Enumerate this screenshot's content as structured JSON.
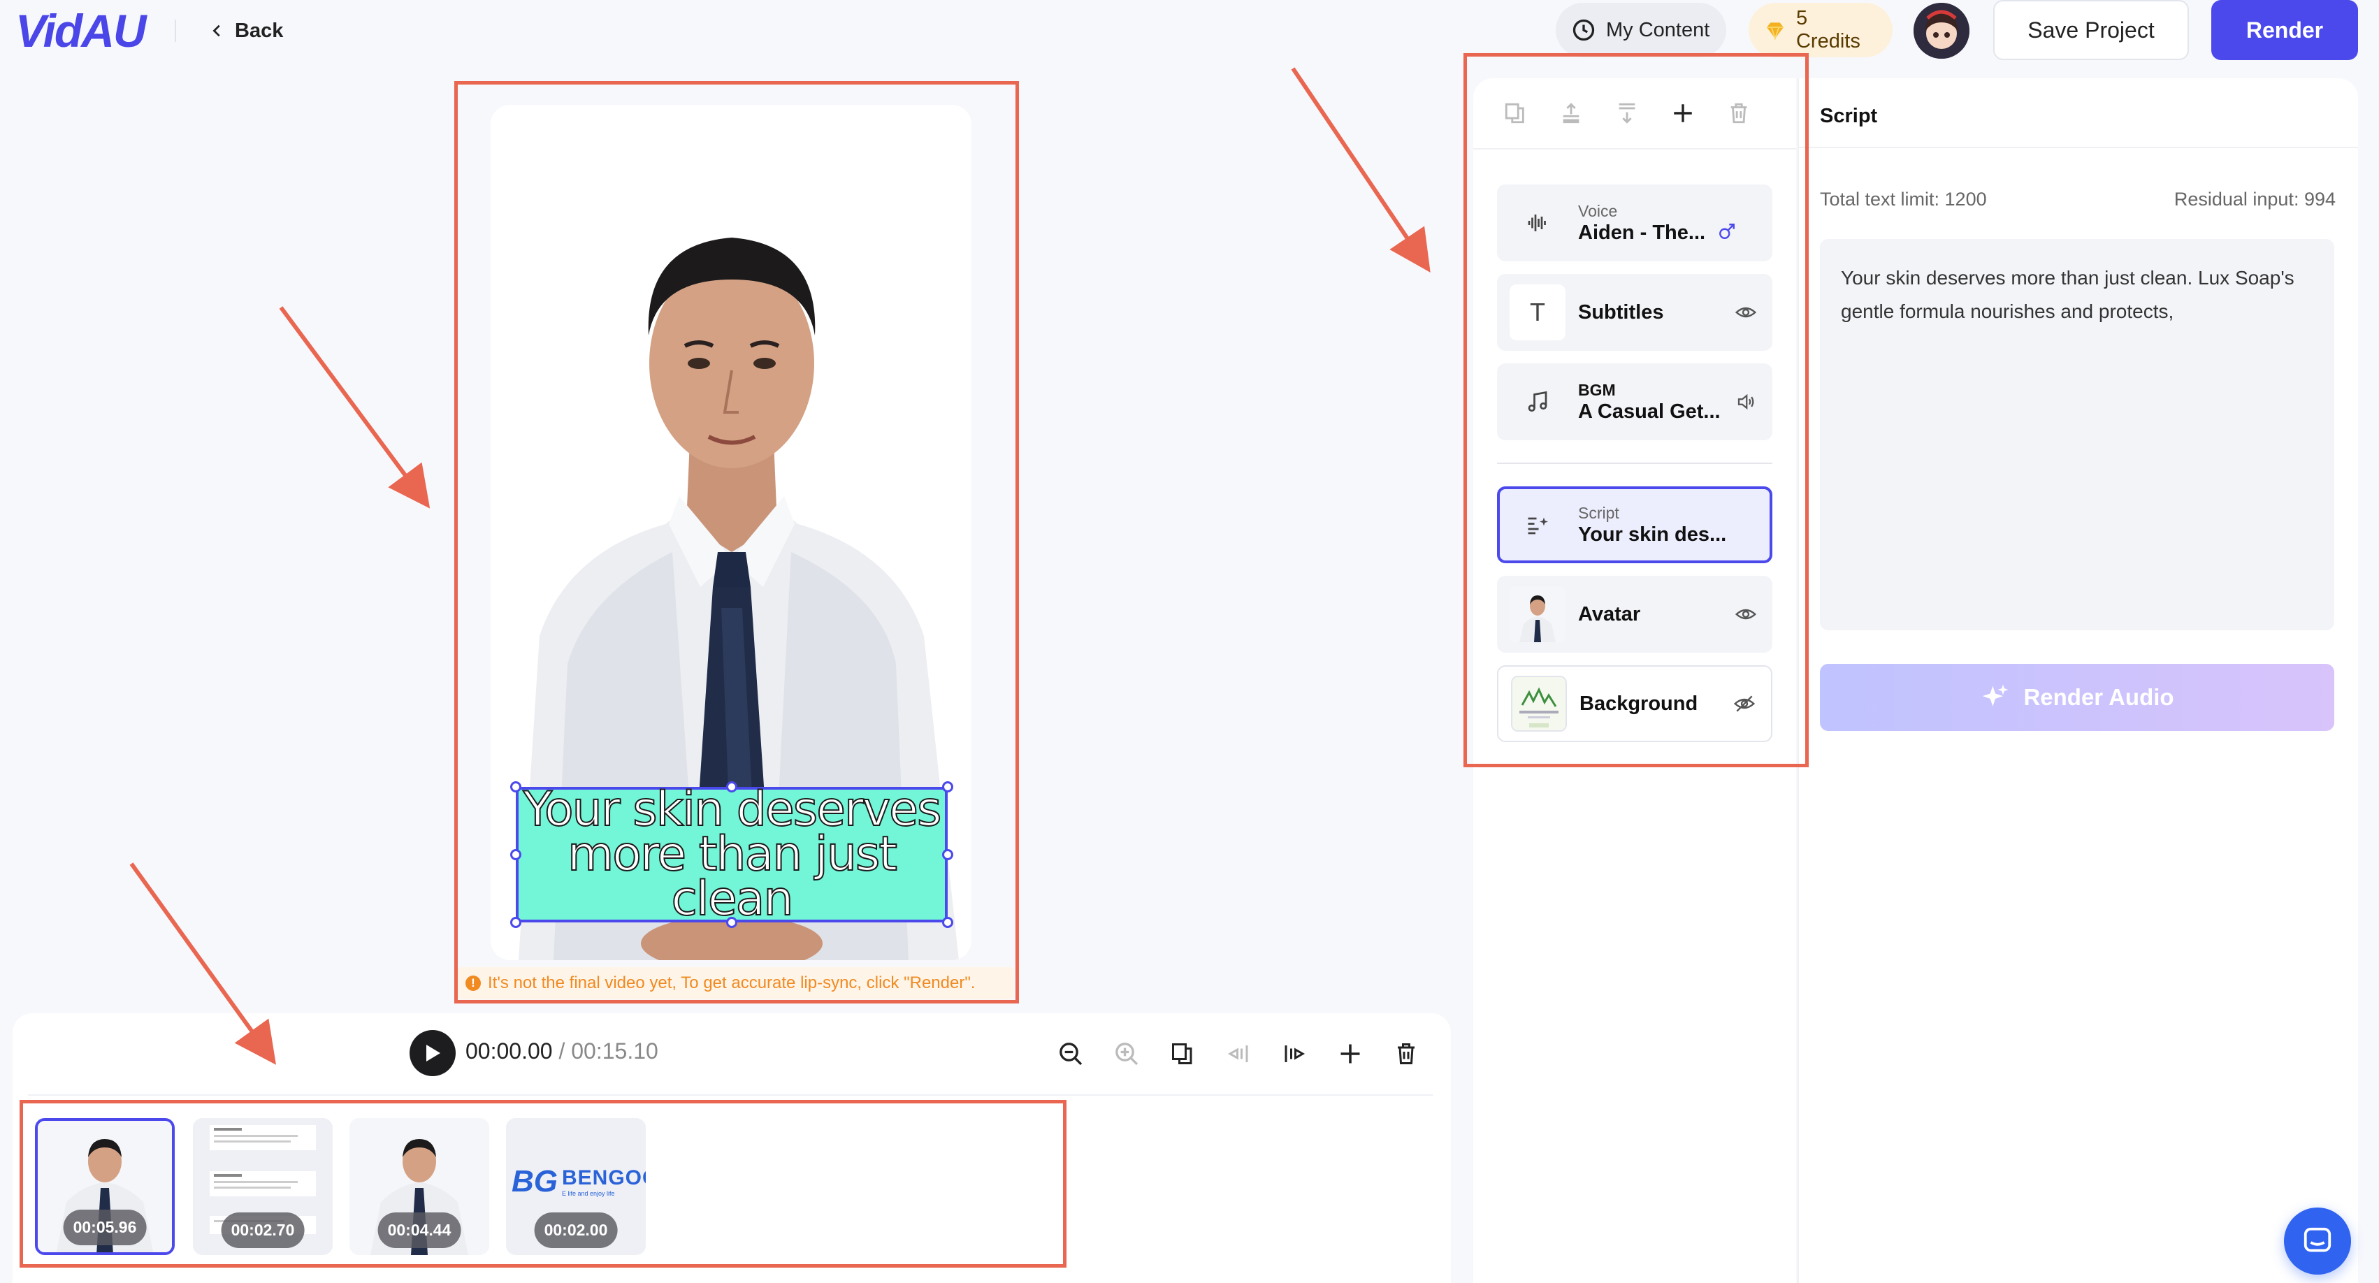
{
  "header": {
    "logo": "VidAU",
    "back_label": "Back",
    "my_content_label": "My Content",
    "credits_label": "5 Credits",
    "save_label": "Save Project",
    "render_label": "Render"
  },
  "preview": {
    "subtitle_text": "Your skin deserves more than just clean",
    "notice": "It's not the final video yet, To get accurate lip-sync, click \"Render\"."
  },
  "timeline": {
    "current_time": "00:00.00",
    "separator": " / ",
    "total_time": "00:15.10",
    "clips": [
      {
        "duration": "00:05.96",
        "kind": "avatar",
        "selected": true
      },
      {
        "duration": "00:02.70",
        "kind": "document",
        "selected": false
      },
      {
        "duration": "00:04.44",
        "kind": "avatar",
        "selected": false
      },
      {
        "duration": "00:02.00",
        "kind": "logo",
        "logo_text": "BENGOO",
        "logo_tagline": "E life and enjoy life",
        "selected": false
      }
    ]
  },
  "layers": [
    {
      "small": "Voice",
      "main": "Aiden - The...",
      "icon": "waveform-icon",
      "action_icon": "male-icon"
    },
    {
      "small": "",
      "main": "Subtitles",
      "icon": "text-icon",
      "action_icon": "eye-icon"
    },
    {
      "small": "BGM",
      "main": "A Casual Get...",
      "icon": "music-note-icon",
      "action_icon": "speaker-icon"
    },
    {
      "small": "Script",
      "main": "Your skin des...",
      "icon": "script-icon",
      "action_icon": "",
      "active": true
    },
    {
      "small": "",
      "main": "Avatar",
      "icon": "avatar-thumb",
      "action_icon": "eye-icon"
    },
    {
      "small": "",
      "main": "Background",
      "icon": "background-thumb",
      "action_icon": "eye-off-icon"
    }
  ],
  "script_panel": {
    "title": "Script",
    "limit_label": "Total text limit: 1200",
    "residual_label": "Residual input: 994",
    "text": "Your skin deserves more than just clean. Lux Soap's gentle formula nourishes and protects,",
    "render_audio_label": "Render Audio"
  },
  "colors": {
    "brand": "#4b49ec",
    "annotation_red": "#e96650",
    "subtitle_bg": "#73f5d7",
    "notice_text": "#f08a21"
  }
}
